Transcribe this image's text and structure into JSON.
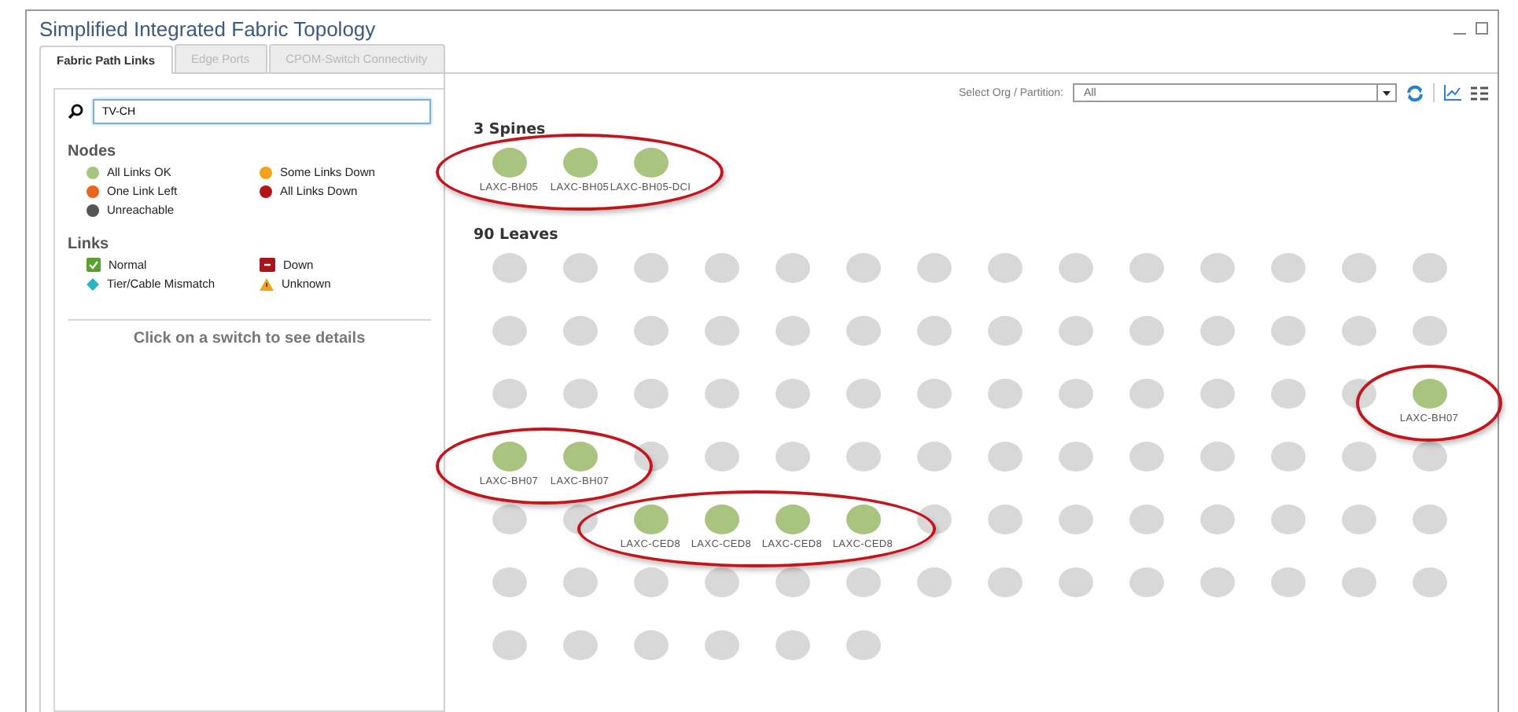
{
  "window": {
    "title": "Simplified Integrated Fabric Topology"
  },
  "tabs": [
    {
      "label": "Fabric Path Links",
      "selected": true
    },
    {
      "label": "Edge Ports",
      "selected": false
    },
    {
      "label": "CPOM-Switch Connectivity",
      "selected": false
    }
  ],
  "search": {
    "value": "TV-CH"
  },
  "legend": {
    "nodes": {
      "title": "Nodes",
      "items": [
        {
          "label": "All Links OK",
          "color": "#a9c47f"
        },
        {
          "label": "Some Links Down",
          "color": "#f5a21b"
        },
        {
          "label": "One Link Left",
          "color": "#e8661c"
        },
        {
          "label": "All Links Down",
          "color": "#b3121a"
        },
        {
          "label": "Unreachable",
          "color": "#555555"
        }
      ]
    },
    "links": {
      "title": "Links",
      "items": [
        {
          "label": "Normal",
          "kind": "check",
          "color": "#5aa02c"
        },
        {
          "label": "Down",
          "kind": "minus",
          "color": "#a8151d"
        },
        {
          "label": "Tier/Cable Mismatch",
          "kind": "diamond",
          "color": "#27b6c4"
        },
        {
          "label": "Unknown",
          "kind": "warning",
          "color": "#f0a21c"
        }
      ]
    }
  },
  "details_hint": "Click on a switch to see details",
  "toolbar": {
    "label": "Select Org / Partition:",
    "select_value": "All"
  },
  "spines": {
    "title": "3 Spines",
    "rows": [
      [
        {
          "color": "#a9c47f",
          "label": "LAXC-BH05",
          "highlighted": true
        },
        {
          "color": "#a9c47f",
          "label": "LAXC-BH05",
          "highlighted": true
        },
        {
          "color": "#a9c47f",
          "label": "LAXC-BH05-DCI",
          "highlighted": true
        }
      ]
    ]
  },
  "leaves": {
    "title": "90 Leaves",
    "rows": [
      [
        {
          "color": "#d8d8d8",
          "highlighted": false
        },
        {
          "color": "#d8d8d8",
          "highlighted": false
        },
        {
          "color": "#d8d8d8",
          "highlighted": false
        },
        {
          "color": "#d8d8d8",
          "highlighted": false
        },
        {
          "color": "#d8d8d8",
          "highlighted": false
        },
        {
          "color": "#d8d8d8",
          "highlighted": false
        },
        {
          "color": "#d8d8d8",
          "highlighted": false
        },
        {
          "color": "#d8d8d8",
          "highlighted": false
        },
        {
          "color": "#d8d8d8",
          "highlighted": false
        },
        {
          "color": "#d8d8d8",
          "highlighted": false
        },
        {
          "color": "#d8d8d8",
          "highlighted": false
        },
        {
          "color": "#d8d8d8",
          "highlighted": false
        },
        {
          "color": "#d8d8d8",
          "highlighted": false
        },
        {
          "color": "#d8d8d8",
          "highlighted": false
        }
      ],
      [
        {
          "color": "#d8d8d8",
          "highlighted": false
        },
        {
          "color": "#d8d8d8",
          "highlighted": false
        },
        {
          "color": "#d8d8d8",
          "highlighted": false
        },
        {
          "color": "#d8d8d8",
          "highlighted": false
        },
        {
          "color": "#d8d8d8",
          "highlighted": false
        },
        {
          "color": "#d8d8d8",
          "highlighted": false
        },
        {
          "color": "#d8d8d8",
          "highlighted": false
        },
        {
          "color": "#d8d8d8",
          "highlighted": false
        },
        {
          "color": "#d8d8d8",
          "highlighted": false
        },
        {
          "color": "#d8d8d8",
          "highlighted": false
        },
        {
          "color": "#d8d8d8",
          "highlighted": false
        },
        {
          "color": "#d8d8d8",
          "highlighted": false
        },
        {
          "color": "#d8d8d8",
          "highlighted": false
        },
        {
          "color": "#d8d8d8",
          "highlighted": false
        }
      ],
      [
        {
          "color": "#d8d8d8",
          "highlighted": false
        },
        {
          "color": "#d8d8d8",
          "highlighted": false
        },
        {
          "color": "#d8d8d8",
          "highlighted": false
        },
        {
          "color": "#d8d8d8",
          "highlighted": false
        },
        {
          "color": "#d8d8d8",
          "highlighted": false
        },
        {
          "color": "#d8d8d8",
          "highlighted": false
        },
        {
          "color": "#d8d8d8",
          "highlighted": false
        },
        {
          "color": "#d8d8d8",
          "highlighted": false
        },
        {
          "color": "#d8d8d8",
          "highlighted": false
        },
        {
          "color": "#d8d8d8",
          "highlighted": false
        },
        {
          "color": "#d8d8d8",
          "highlighted": false
        },
        {
          "color": "#d8d8d8",
          "highlighted": false
        },
        {
          "color": "#d8d8d8",
          "highlighted": false
        },
        {
          "color": "#a9c47f",
          "label": "LAXC-BH07",
          "highlighted": true
        }
      ],
      [
        {
          "color": "#a9c47f",
          "label": "LAXC-BH07",
          "highlighted": true
        },
        {
          "color": "#a9c47f",
          "label": "LAXC-BH07",
          "highlighted": true
        },
        {
          "color": "#d8d8d8",
          "highlighted": false
        },
        {
          "color": "#d8d8d8",
          "highlighted": false
        },
        {
          "color": "#d8d8d8",
          "highlighted": false
        },
        {
          "color": "#d8d8d8",
          "highlighted": false
        },
        {
          "color": "#d8d8d8",
          "highlighted": false
        },
        {
          "color": "#d8d8d8",
          "highlighted": false
        },
        {
          "color": "#d8d8d8",
          "highlighted": false
        },
        {
          "color": "#d8d8d8",
          "highlighted": false
        },
        {
          "color": "#d8d8d8",
          "highlighted": false
        },
        {
          "color": "#d8d8d8",
          "highlighted": false
        },
        {
          "color": "#d8d8d8",
          "highlighted": false
        },
        {
          "color": "#d8d8d8",
          "highlighted": false
        }
      ],
      [
        {
          "color": "#d8d8d8",
          "highlighted": false
        },
        {
          "color": "#d8d8d8",
          "highlighted": false
        },
        {
          "color": "#a9c47f",
          "label": "LAXC-CED8",
          "highlighted": true
        },
        {
          "color": "#a9c47f",
          "label": "LAXC-CED8",
          "highlighted": true
        },
        {
          "color": "#a9c47f",
          "label": "LAXC-CED8",
          "highlighted": true
        },
        {
          "color": "#a9c47f",
          "label": "LAXC-CED8",
          "highlighted": true
        },
        {
          "color": "#d8d8d8",
          "highlighted": false
        },
        {
          "color": "#d8d8d8",
          "highlighted": false
        },
        {
          "color": "#d8d8d8",
          "highlighted": false
        },
        {
          "color": "#d8d8d8",
          "highlighted": false
        },
        {
          "color": "#d8d8d8",
          "highlighted": false
        },
        {
          "color": "#d8d8d8",
          "highlighted": false
        },
        {
          "color": "#d8d8d8",
          "highlighted": false
        },
        {
          "color": "#d8d8d8",
          "highlighted": false
        }
      ],
      [
        {
          "color": "#d8d8d8",
          "highlighted": false
        },
        {
          "color": "#d8d8d8",
          "highlighted": false
        },
        {
          "color": "#d8d8d8",
          "highlighted": false
        },
        {
          "color": "#d8d8d8",
          "highlighted": false
        },
        {
          "color": "#d8d8d8",
          "highlighted": false
        },
        {
          "color": "#d8d8d8",
          "highlighted": false
        },
        {
          "color": "#d8d8d8",
          "highlighted": false
        },
        {
          "color": "#d8d8d8",
          "highlighted": false
        },
        {
          "color": "#d8d8d8",
          "highlighted": false
        },
        {
          "color": "#d8d8d8",
          "highlighted": false
        },
        {
          "color": "#d8d8d8",
          "highlighted": false
        },
        {
          "color": "#d8d8d8",
          "highlighted": false
        },
        {
          "color": "#d8d8d8",
          "highlighted": false
        },
        {
          "color": "#d8d8d8",
          "highlighted": false
        }
      ],
      [
        {
          "color": "#d8d8d8",
          "highlighted": false
        },
        {
          "color": "#d8d8d8",
          "highlighted": false
        },
        {
          "color": "#d8d8d8",
          "highlighted": false
        },
        {
          "color": "#d8d8d8",
          "highlighted": false
        },
        {
          "color": "#d8d8d8",
          "highlighted": false
        },
        {
          "color": "#d8d8d8",
          "highlighted": false
        }
      ]
    ]
  }
}
